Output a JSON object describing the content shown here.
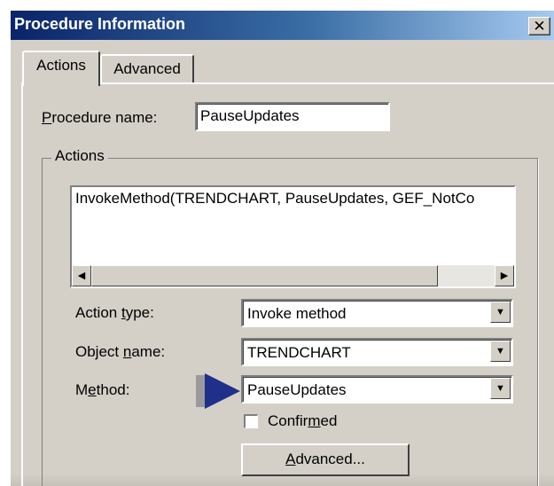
{
  "window": {
    "title": "Procedure Information",
    "close_glyph": "✕"
  },
  "tabs": [
    {
      "label": "Actions",
      "active": true
    },
    {
      "label": "Advanced",
      "active": false
    }
  ],
  "procedure_name": {
    "label_prefix": "",
    "label_mnemonic": "P",
    "label_rest": "rocedure name:",
    "value": "PauseUpdates"
  },
  "actions_group": {
    "legend": "Actions",
    "list_text": "InvokeMethod(TRENDCHART, PauseUpdates, GEF_NotCo"
  },
  "fields": {
    "action_type": {
      "label_prefix": "Action ",
      "label_mnemonic": "t",
      "label_rest": "ype:",
      "value": "Invoke method"
    },
    "object_name": {
      "label_prefix": "Object ",
      "label_mnemonic": "n",
      "label_rest": "ame:",
      "value": "TRENDCHART"
    },
    "method": {
      "label_prefix": "M",
      "label_mnemonic": "e",
      "label_rest": "thod:",
      "value": "PauseUpdates"
    }
  },
  "confirmed": {
    "label_prefix": "Confir",
    "label_mnemonic": "m",
    "label_rest": "ed",
    "checked": false
  },
  "advanced_button": {
    "label_prefix": "",
    "label_mnemonic": "A",
    "label_rest": "dvanced..."
  },
  "icons": {
    "scroll_left": "◀",
    "scroll_right": "▶",
    "dropdown": "▼",
    "pointer_arrow": "pointer-arrow-icon"
  },
  "colors": {
    "title_start": "#0a246a",
    "title_end": "#a6caf0",
    "face": "#d4d0c8",
    "arrow": "#1f2f8a"
  }
}
